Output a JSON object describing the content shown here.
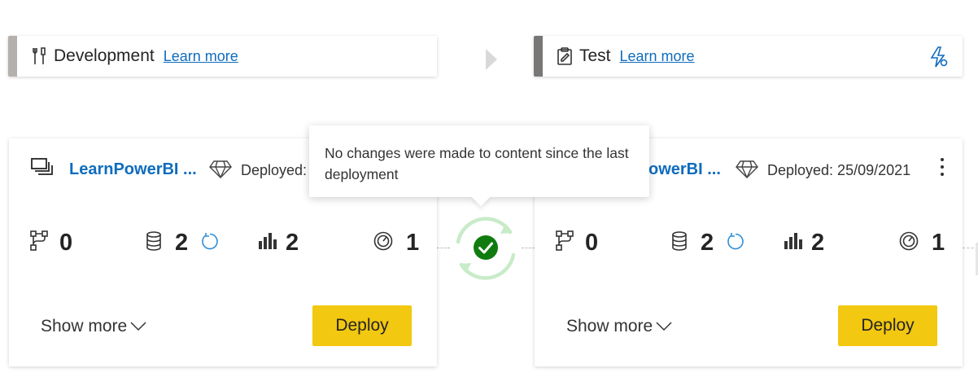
{
  "stages": [
    {
      "title": "Development",
      "learn_more": "Learn more",
      "icon": "tools-icon",
      "bar_color": "#b3b0ad"
    },
    {
      "title": "Test",
      "learn_more": "Learn more",
      "icon": "clipboard-icon",
      "bar_color": "#797775"
    }
  ],
  "cards": [
    {
      "workspace": "LearnPowerBI ...",
      "deployed": "Deployed:",
      "metrics": {
        "dataflows": "0",
        "datasets": "2",
        "reports": "2",
        "dashboards": "1"
      },
      "show_more": "Show more",
      "deploy": "Deploy"
    },
    {
      "workspace": "owerBI ...",
      "deployed": "Deployed: 25/09/2021",
      "metrics": {
        "dataflows": "0",
        "datasets": "2",
        "reports": "2",
        "dashboards": "1"
      },
      "show_more": "Show more",
      "deploy": "Deploy"
    }
  ],
  "tooltip": {
    "text": "No changes were made to content since the last deployment"
  },
  "colors": {
    "accent": "#0f6cbd",
    "deploy": "#f2c811",
    "success": "#107c10",
    "sync_ring": "#c8ebc8"
  }
}
